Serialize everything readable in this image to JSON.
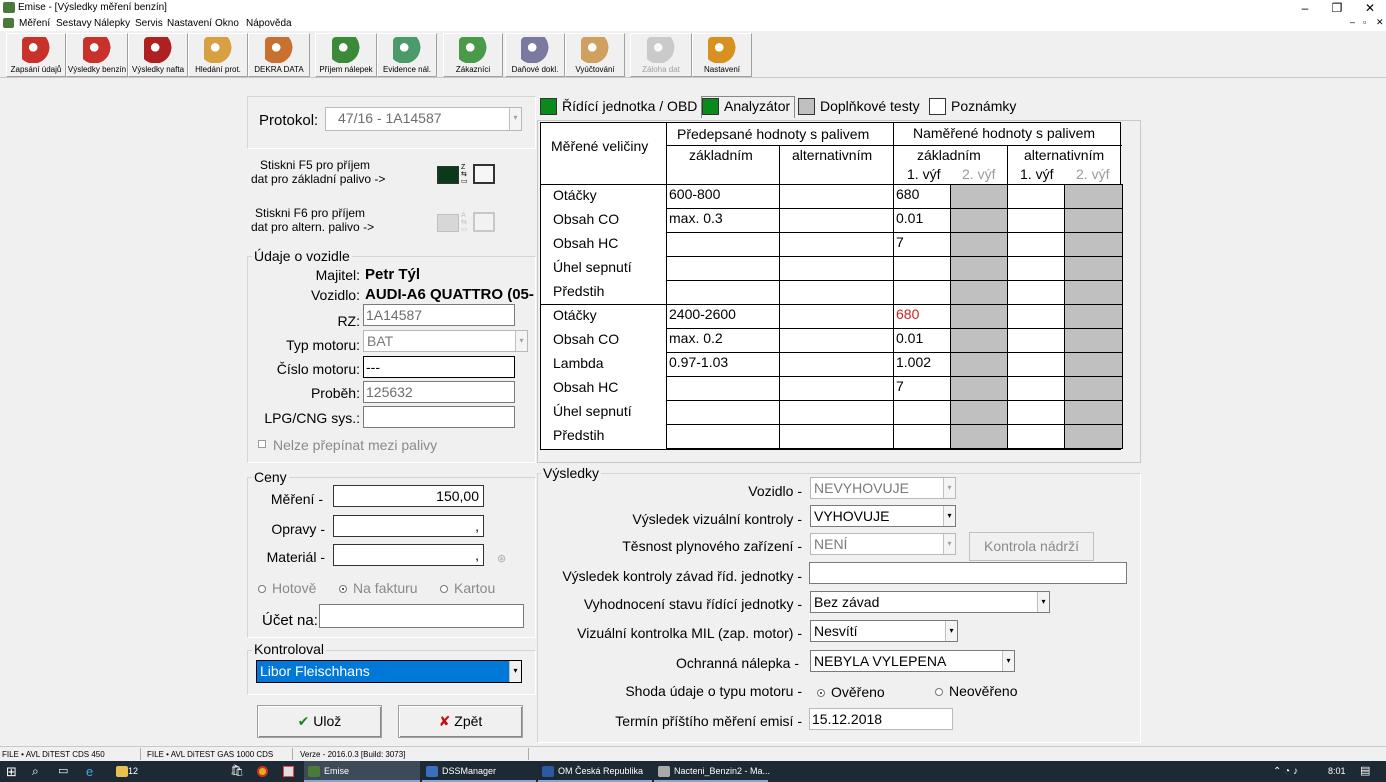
{
  "window": {
    "title": "Emise - [Výsledky měření benzín]",
    "controls": [
      "–",
      "❐",
      "✕"
    ],
    "mdi_controls": [
      "–",
      "▫",
      "✕"
    ]
  },
  "menu": [
    "Měření",
    "Sestavy",
    "Nálepky",
    "Servis",
    "Nastavení",
    "Okno",
    "Nápověda"
  ],
  "toolbar": [
    {
      "label": "Zapsání údajů",
      "icon": "car-edit-icon",
      "color": "#c8322a",
      "enabled": true
    },
    {
      "label": "Výsledky benzín",
      "icon": "car-red-icon",
      "color": "#c8322a",
      "enabled": true
    },
    {
      "label": "Výsledky nafta",
      "icon": "car-red-icon",
      "color": "#b02020",
      "enabled": true
    },
    {
      "label": "Hledání prot.",
      "icon": "document-search-icon",
      "color": "#d8a040",
      "enabled": true
    },
    {
      "label": "DEKRA DATA",
      "icon": "document-data-icon",
      "color": "#c87030",
      "enabled": true
    },
    {
      "label": "Příjem nálepek",
      "icon": "sticker-receive-icon",
      "color": "#3a8a3a",
      "enabled": true
    },
    {
      "label": "Evidence nál.",
      "icon": "sticker-register-icon",
      "color": "#4a9a6a",
      "enabled": true
    },
    {
      "label": "Zákazníci",
      "icon": "customers-icon",
      "color": "#4a9a4a",
      "enabled": true
    },
    {
      "label": "Daňové dokl.",
      "icon": "tax-document-icon",
      "color": "#7a7aa0",
      "enabled": true
    },
    {
      "label": "Vyúčtování",
      "icon": "invoice-icon",
      "color": "#d0a060",
      "enabled": true
    },
    {
      "label": "Záloha dat",
      "icon": "backup-icon",
      "color": "#b0b0b0",
      "enabled": false
    },
    {
      "label": "Nastavení",
      "icon": "settings-tools-icon",
      "color": "#d89020",
      "enabled": true
    }
  ],
  "protocol": {
    "label": "Protokol:",
    "value": "47/16 - 1A14587"
  },
  "f5_hint": {
    "line1": "Stiskni F5 pro příjem",
    "line2": "dat pro základní palivo ->"
  },
  "f6_hint": {
    "line1": "Stiskni F6 pro příjem",
    "line2": "dat pro altern. palivo ->"
  },
  "vehicle": {
    "title": "Údaje o vozidle",
    "owner_label": "Majitel:",
    "owner": "Petr Týl",
    "vehicle_label": "Vozidlo:",
    "vehicle": "AUDI-A6 QUATTRO (05-",
    "rz_label": "RZ:",
    "rz": "1A14587",
    "engine_type_label": "Typ motoru:",
    "engine_type": "BAT",
    "engine_no_label": "Číslo motoru:",
    "engine_no": "---",
    "mileage_label": "Proběh:",
    "mileage": "125632",
    "lpg_label": "LPG/CNG sys.:",
    "lpg": "",
    "no_switch_label": "Nelze přepínat mezi palivy"
  },
  "prices": {
    "title": "Ceny",
    "measure_label": "Měření -",
    "measure": "150,00",
    "repairs_label": "Opravy -",
    "repairs": ",",
    "material_label": "Materiál -",
    "material": ",",
    "pay_cash": "Hotově",
    "pay_invoice": "Na fakturu",
    "pay_card": "Kartou",
    "account_label": "Účet na:",
    "account": ""
  },
  "inspector": {
    "title": "Kontroloval",
    "value": "Libor Fleischhans"
  },
  "buttons": {
    "save": "Ulož",
    "back": "Zpět",
    "save_icon": "✔",
    "back_icon": "✘"
  },
  "tabs": [
    {
      "label": "Řídící jednotka / OBD",
      "color": "#0a8a1a"
    },
    {
      "label": "Analyzátor",
      "color": "#0a8a1a"
    },
    {
      "label": "Doplňkové testy",
      "color": "#c0c0c0"
    },
    {
      "label": "Poznámky",
      "color": "#ffffff"
    }
  ],
  "table": {
    "col_quantities": "Měřené veličiny",
    "col_prescribed": "Předepsané hodnoty s palivem",
    "col_measured": "Naměřené hodnoty s palivem",
    "basic": "základním",
    "alternative": "alternativním",
    "exh1": "1. výf",
    "exh2": "2. výf",
    "idle_rows": [
      {
        "name": "Otáčky",
        "presc_basic": "600-800",
        "presc_alt": "",
        "meas": "680"
      },
      {
        "name": "Obsah CO",
        "presc_basic": "max. 0.3",
        "presc_alt": "",
        "meas": "0.01"
      },
      {
        "name": "Obsah HC",
        "presc_basic": "",
        "presc_alt": "",
        "meas": "7"
      },
      {
        "name": "Úhel sepnutí",
        "presc_basic": "",
        "presc_alt": "",
        "meas": ""
      },
      {
        "name": "Předstih",
        "presc_basic": "",
        "presc_alt": "",
        "meas": ""
      }
    ],
    "high_rows": [
      {
        "name": "Otáčky",
        "presc_basic": "2400-2600",
        "presc_alt": "",
        "meas": "680"
      },
      {
        "name": "Obsah CO",
        "presc_basic": "max. 0.2",
        "presc_alt": "",
        "meas": "0.01"
      },
      {
        "name": "Lambda",
        "presc_basic": "0.97-1.03",
        "presc_alt": "",
        "meas": "1.002"
      },
      {
        "name": "Obsah HC",
        "presc_basic": "",
        "presc_alt": "",
        "meas": "7"
      },
      {
        "name": "Úhel sepnutí",
        "presc_basic": "",
        "presc_alt": "",
        "meas": ""
      },
      {
        "name": "Předstih",
        "presc_basic": "",
        "presc_alt": "",
        "meas": ""
      }
    ],
    "out_of_range_color": "#d02020"
  },
  "results": {
    "title": "Výsledky",
    "vehicle_label": "Vozidlo -",
    "vehicle": "NEVYHOVUJE",
    "visual_label": "Výsledek vizuální kontroly -",
    "visual": "VYHOVUJE",
    "gas_tight_label": "Těsnost plynového zařízení -",
    "gas_tight": "NENÍ",
    "tank_check_button": "Kontrola nádrží",
    "ecu_faults_label": "Výsledek kontroly závad říd. jednotky -",
    "ecu_faults": "",
    "ecu_eval_label": "Vyhodnocení stavu řídící jednotky -",
    "ecu_eval": "Bez závad",
    "mil_label": "Vizuální kontrolka MIL (zap. motor) -",
    "mil": "Nesvítí",
    "sticker_label": "Ochranná nálepka -",
    "sticker": "NEBYLA VYLEPENA",
    "engine_match_label": "Shoda údaje o typu motoru -",
    "verified": "Ověřeno",
    "not_verified": "Neověřeno",
    "next_label": "Termín příštího měření emisí -",
    "next": "15.12.2018"
  },
  "status": {
    "s1": "FILE • AVL DiTEST CDS 450",
    "s2": "FILE • AVL DiTEST GAS 1000 CDS",
    "s3": "Verze - 2016.0.3 [Build: 3073]"
  },
  "taskbar": {
    "folder": "12",
    "apps": [
      "Emise",
      "DSSManager",
      "OM Česká Republika",
      "Nacteni_Benzin2 - Ma..."
    ],
    "tray_icons": "⌃ ◔ ♪",
    "clock": "8:01"
  }
}
